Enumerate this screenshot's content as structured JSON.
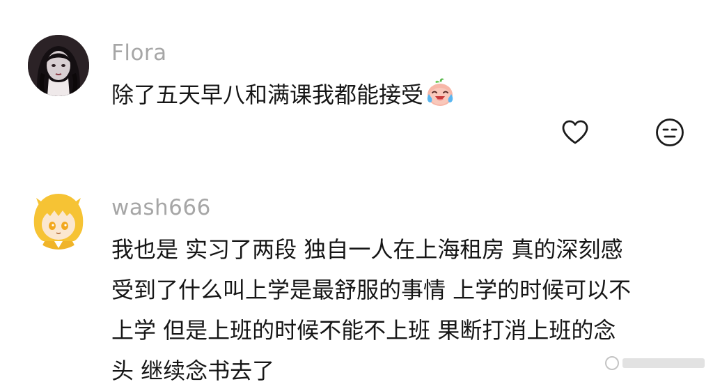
{
  "comments": [
    {
      "username": "Flora",
      "text": "除了五天早八和满课我都能接受",
      "emoji": "crying-laughing-peach-emoji"
    },
    {
      "username": "wash666",
      "lines": [
        "我也是 实习了两段 独自一人在上海租房 真的深刻感",
        "受到了什么叫上学是最舒服的事情 上学的时候可以不",
        "上学 但是上班的时候不能不上班 果断打消上班的念",
        "头 继续念书去了"
      ]
    }
  ],
  "actions": {
    "like_icon": "heart-outline-icon",
    "dislike_icon": "neutral-face-icon"
  },
  "colors": {
    "username": "#a6a6a6",
    "text": "#161616",
    "icon": "#1a1a1a"
  }
}
